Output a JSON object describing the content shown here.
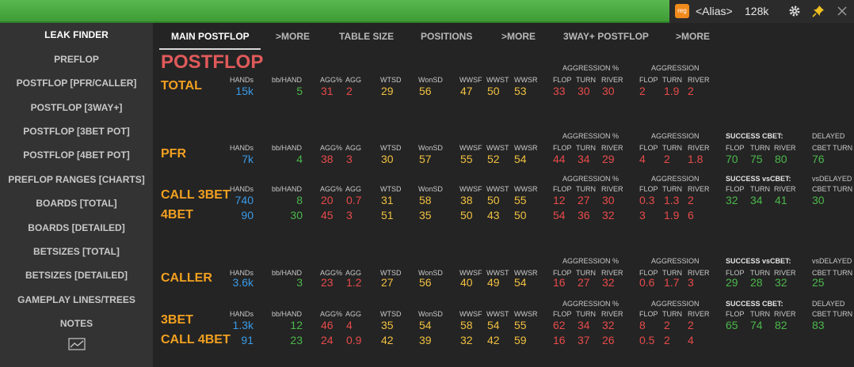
{
  "topbar": {
    "badge": "reg",
    "alias": "<Alias>",
    "hands": "128k",
    "icons": [
      "gear-icon",
      "pin-icon",
      "close-icon"
    ]
  },
  "sidebar": {
    "items": [
      {
        "label": "LEAK FINDER",
        "active": true
      },
      {
        "label": "PREFLOP"
      },
      {
        "label": "POSTFLOP [PFR/CALLER]"
      },
      {
        "label": "POSTFLOP [3WAY+]"
      },
      {
        "label": "POSTFLOP [3BET POT]"
      },
      {
        "label": "POSTFLOP [4BET POT]"
      },
      {
        "label": "PREFLOP RANGES [CHARTS]"
      },
      {
        "label": "BOARDS [TOTAL]"
      },
      {
        "label": "BOARDS [DETAILED]"
      },
      {
        "label": "BETSIZES [TOTAL]"
      },
      {
        "label": "BETSIZES [DETAILED]"
      },
      {
        "label": "GAMEPLAY LINES/TREES"
      },
      {
        "label": "NOTES"
      }
    ],
    "chart_icon": "line-chart-icon"
  },
  "tabs": [
    {
      "label": "MAIN POSTFLOP",
      "active": true
    },
    {
      "label": ">MORE"
    },
    {
      "label": "TABLE SIZE"
    },
    {
      "label": "POSITIONS"
    },
    {
      "label": ">MORE"
    },
    {
      "label": "3WAY+ POSTFLOP"
    },
    {
      "label": ">MORE"
    }
  ],
  "title": "POSTFLOP",
  "labels": {
    "hands": "HANDs",
    "bb_hand": "bb/HAND",
    "agg_pct": "AGG%",
    "agg": "AGG",
    "wtsd": "WTSD",
    "wonsd": "WonSD",
    "wwsf": "WWSF",
    "wwst": "WWST",
    "wwsr": "WWSR",
    "aggression_pct": "AGGRESSION %",
    "aggression": "AGGRESSION",
    "flop": "FLOP",
    "turn": "TURN",
    "river": "RIVER",
    "success_cbet": "SUCCESS CBET:",
    "success_vscbet": "SUCCESS vsCBET:",
    "delayed": "DELAYED",
    "vsdelayed": "vsDELAYED",
    "cbet_turn": "CBET TURN"
  },
  "rows": {
    "total": {
      "name": "TOTAL",
      "hands": "15k",
      "bb_hand": "5",
      "agg_pct": "31",
      "agg": "2",
      "wtsd": "29",
      "wonsd": "56",
      "wwsf": "47",
      "wwst": "50",
      "wwsr": "53",
      "aggp_flop": "33",
      "aggp_turn": "30",
      "aggp_river": "30",
      "agg_flop": "2",
      "agg_turn": "1.9",
      "agg_river": "2"
    },
    "pfr": {
      "name": "PFR",
      "hands": "7k",
      "bb_hand": "4",
      "agg_pct": "38",
      "agg": "3",
      "wtsd": "30",
      "wonsd": "57",
      "wwsf": "55",
      "wwst": "52",
      "wwsr": "54",
      "aggp_flop": "44",
      "aggp_turn": "34",
      "aggp_river": "29",
      "agg_flop": "4",
      "agg_turn": "2",
      "agg_river": "1.8",
      "s_flop": "70",
      "s_turn": "75",
      "s_river": "80",
      "delayed": "76"
    },
    "call3bet": {
      "name": "CALL 3BET",
      "hands": "740",
      "bb_hand": "8",
      "agg_pct": "20",
      "agg": "0.7",
      "wtsd": "31",
      "wonsd": "58",
      "wwsf": "38",
      "wwst": "50",
      "wwsr": "55",
      "aggp_flop": "12",
      "aggp_turn": "27",
      "aggp_river": "30",
      "agg_flop": "0.3",
      "agg_turn": "1.3",
      "agg_river": "2",
      "s_flop": "32",
      "s_turn": "34",
      "s_river": "41",
      "delayed": "30"
    },
    "bet4": {
      "name": "4BET",
      "hands": "90",
      "bb_hand": "30",
      "agg_pct": "45",
      "agg": "3",
      "wtsd": "51",
      "wonsd": "35",
      "wwsf": "50",
      "wwst": "43",
      "wwsr": "50",
      "aggp_flop": "54",
      "aggp_turn": "36",
      "aggp_river": "32",
      "agg_flop": "3",
      "agg_turn": "1.9",
      "agg_river": "6"
    },
    "caller": {
      "name": "CALLER",
      "hands": "3.6k",
      "bb_hand": "3",
      "agg_pct": "23",
      "agg": "1.2",
      "wtsd": "27",
      "wonsd": "56",
      "wwsf": "40",
      "wwst": "49",
      "wwsr": "54",
      "aggp_flop": "16",
      "aggp_turn": "27",
      "aggp_river": "32",
      "agg_flop": "0.6",
      "agg_turn": "1.7",
      "agg_river": "3",
      "s_flop": "29",
      "s_turn": "28",
      "s_river": "32",
      "delayed": "25"
    },
    "bet3": {
      "name": "3BET",
      "hands": "1.3k",
      "bb_hand": "12",
      "agg_pct": "46",
      "agg": "4",
      "wtsd": "35",
      "wonsd": "54",
      "wwsf": "58",
      "wwst": "54",
      "wwsr": "55",
      "aggp_flop": "62",
      "aggp_turn": "34",
      "aggp_river": "32",
      "agg_flop": "8",
      "agg_turn": "2",
      "agg_river": "2",
      "s_flop": "65",
      "s_turn": "74",
      "s_river": "82",
      "delayed": "83"
    },
    "call4bet": {
      "name": "CALL 4BET",
      "hands": "91",
      "bb_hand": "23",
      "agg_pct": "24",
      "agg": "0.9",
      "wtsd": "42",
      "wonsd": "39",
      "wwsf": "32",
      "wwst": "42",
      "wwsr": "59",
      "aggp_flop": "16",
      "aggp_turn": "37",
      "aggp_river": "26",
      "agg_flop": "0.5",
      "agg_turn": "2",
      "agg_river": "4"
    }
  },
  "colors": {
    "accent_green": "#4cb84c",
    "title_red": "#e05a5a",
    "section_orange": "#f2a020",
    "hands_blue": "#3a9be8",
    "stat_red": "#e84a4a",
    "stat_yellow": "#f0c040"
  }
}
